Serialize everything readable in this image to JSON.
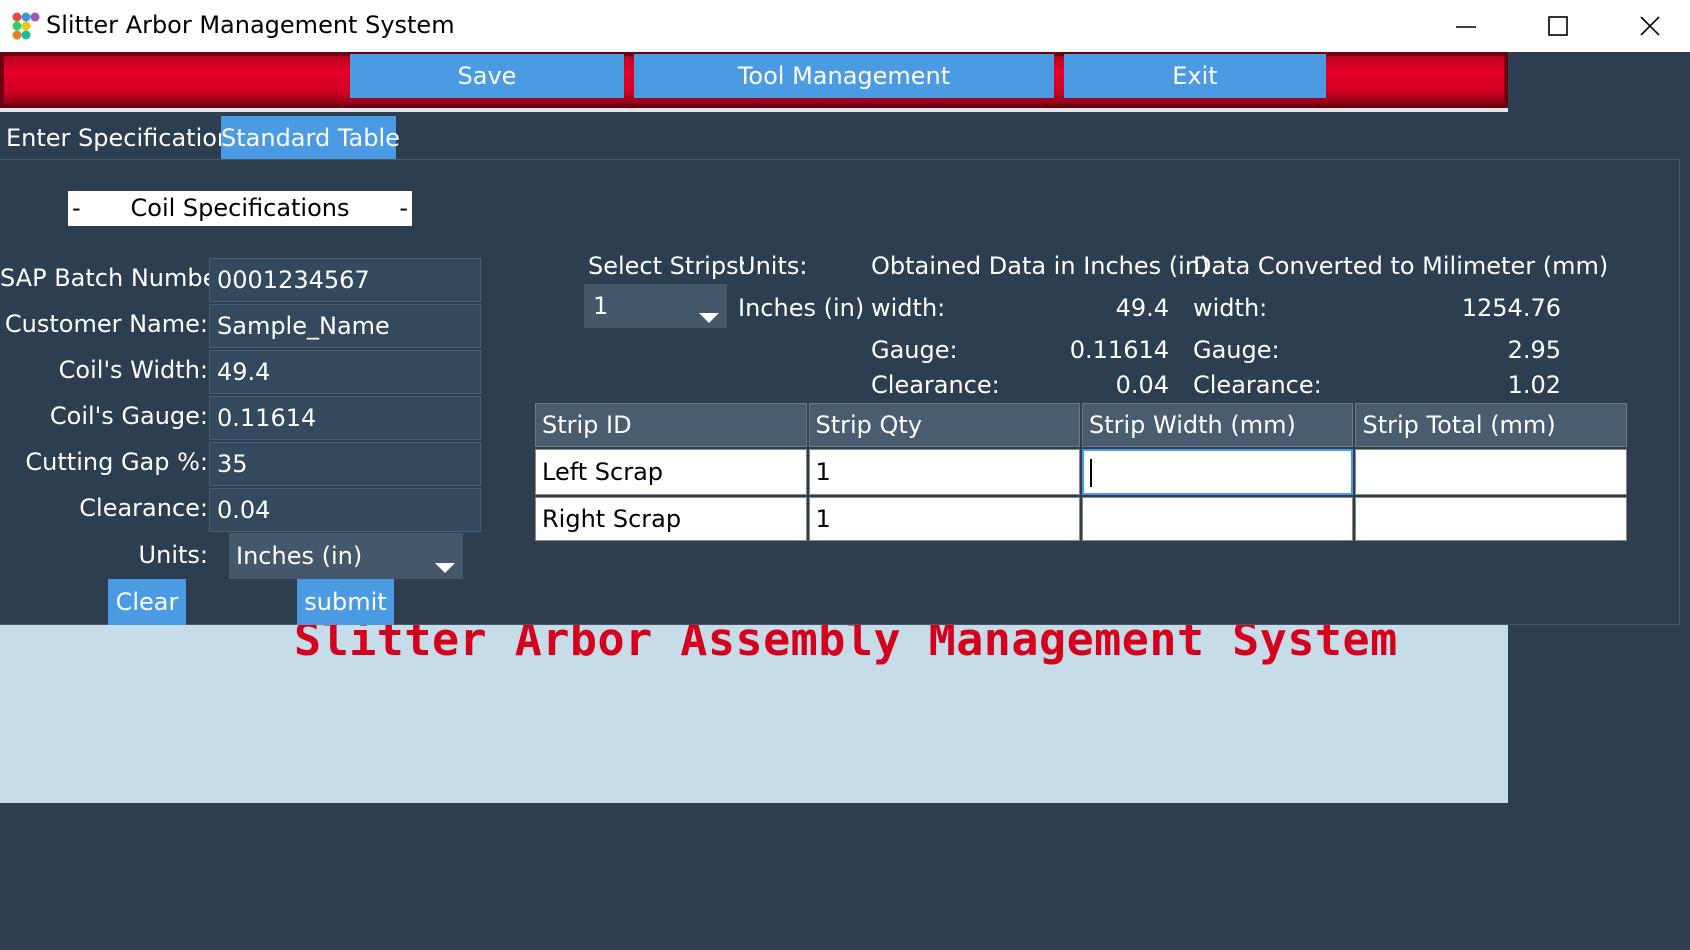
{
  "window": {
    "title": "Slitter Arbor Management System",
    "icon_name": "app-dots-icon",
    "controls": [
      "minimize-icon",
      "maximize-icon",
      "close-icon"
    ]
  },
  "toolbar": {
    "save_label": "Save",
    "tool_management_label": "Tool Management",
    "exit_label": "Exit"
  },
  "tabs": [
    {
      "label": "Enter Specifications",
      "selected": false
    },
    {
      "label": "Standard Table",
      "selected": true
    }
  ],
  "coil_specs": {
    "header": "Coil Specifications",
    "dash": "-",
    "fields": [
      {
        "label": "SAP Batch Number:",
        "value": "0001234567"
      },
      {
        "label": "Customer Name:",
        "value": "Sample_Name"
      },
      {
        "label": "Coil's Width:",
        "value": "49.4"
      },
      {
        "label": "Coil's Gauge:",
        "value": "0.11614"
      },
      {
        "label": "Cutting Gap %:",
        "value": "35"
      },
      {
        "label": "Clearance:",
        "value": "0.04"
      }
    ],
    "units_label": "Units:",
    "units_value": "Inches (in)",
    "clear_label": "Clear",
    "submit_label": "submit"
  },
  "strips": {
    "select_label": "Select Strips:",
    "select_value": "1",
    "units_label": "Units:",
    "units_value": "Inches (in)"
  },
  "obtained": {
    "header": "Obtained Data in Inches (in)",
    "width_label": "width:",
    "width_value": "49.4",
    "gauge_label": "Gauge:",
    "gauge_value": "0.11614",
    "clearance_label": "Clearance:",
    "clearance_value": "0.04"
  },
  "converted": {
    "header": "Data Converted to Milimeter (mm)",
    "width_label": "width:",
    "width_value": "1254.76",
    "gauge_label": "Gauge:",
    "gauge_value": "2.95",
    "clearance_label": "Clearance:",
    "clearance_value": "1.02"
  },
  "table": {
    "columns": [
      "Strip ID",
      "Strip Qty",
      "Strip Width (mm)",
      "Strip Total (mm)"
    ],
    "rows": [
      [
        "Left Scrap",
        "1",
        "",
        ""
      ],
      [
        "Right Scrap",
        "1",
        "",
        ""
      ]
    ]
  },
  "watermark": "Slitter Arbor Assembly Management System",
  "colors": {
    "background": "#2c3e50",
    "button_blue": "#4a9be3",
    "banner_red": "#e8002a",
    "watermark_red": "#d4001c",
    "lower_panel": "#c6dce9"
  }
}
